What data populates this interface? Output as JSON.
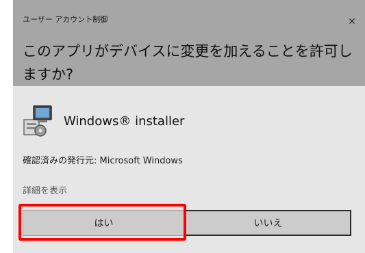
{
  "dialog": {
    "title": "ユーザー アカウント制御",
    "close_glyph": "✕",
    "question": "このアプリがデバイスに変更を加えることを許可しますか?"
  },
  "app": {
    "icon": "installer-package-icon",
    "name": "Windows® installer"
  },
  "publisher_text": "確認済みの発行元: Microsoft Windows",
  "details_link": "詳細を表示",
  "buttons": {
    "yes": "はい",
    "no": "いいえ"
  },
  "annotation": {
    "highlight_color": "#ff0000",
    "highlighted_target": "yes"
  }
}
